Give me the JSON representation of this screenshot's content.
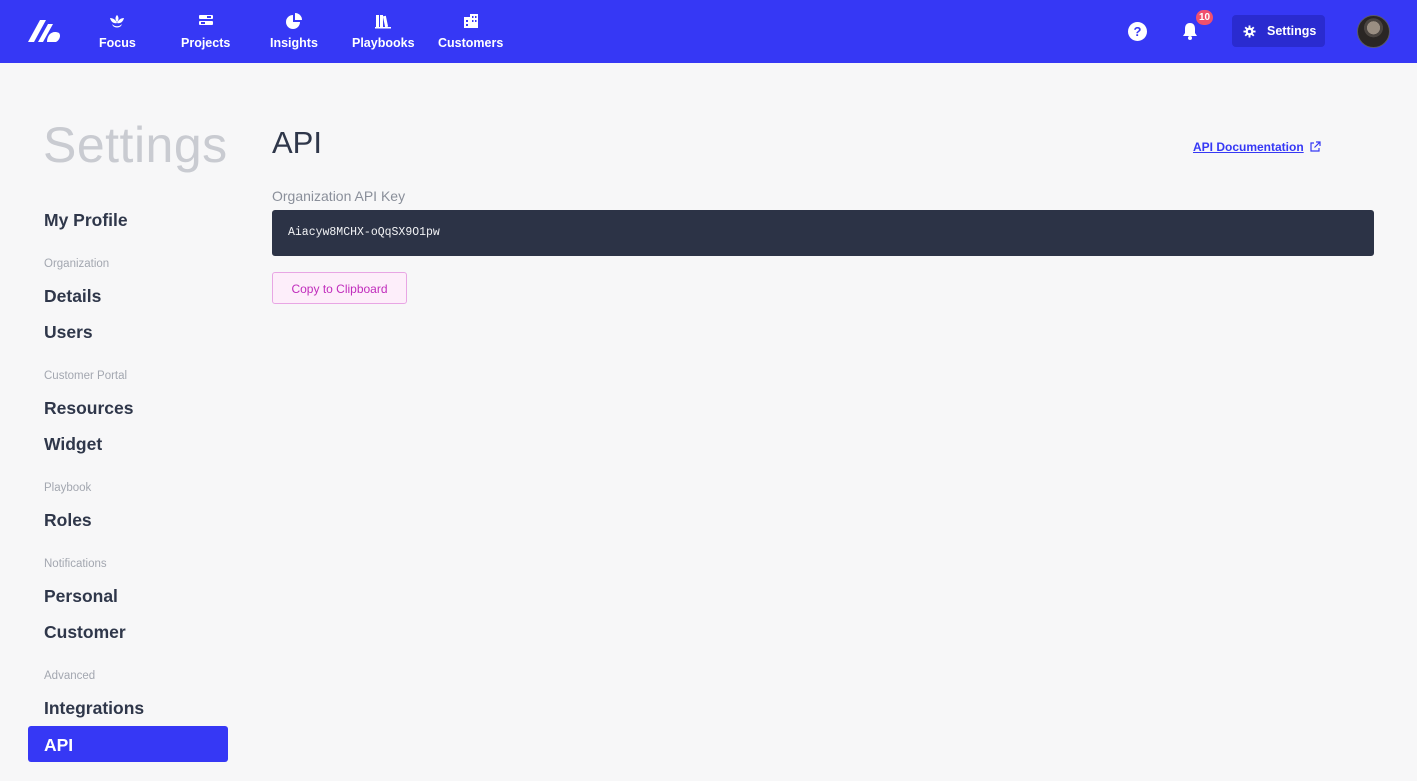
{
  "nav": {
    "items": [
      {
        "label": "Focus",
        "icon": "lotus-icon"
      },
      {
        "label": "Projects",
        "icon": "projects-icon"
      },
      {
        "label": "Insights",
        "icon": "pie-chart-icon"
      },
      {
        "label": "Playbooks",
        "icon": "books-icon"
      },
      {
        "label": "Customers",
        "icon": "building-icon"
      }
    ],
    "help_label": "?",
    "notification_count": "10",
    "settings_label": "Settings",
    "brand_color": "#3638f5"
  },
  "sidebar": {
    "title": "Settings",
    "my_profile": "My Profile",
    "sections": [
      {
        "heading": "Organization",
        "items": [
          "Details",
          "Users"
        ]
      },
      {
        "heading": "Customer Portal",
        "items": [
          "Resources",
          "Widget"
        ]
      },
      {
        "heading": "Playbook",
        "items": [
          "Roles"
        ]
      },
      {
        "heading": "Notifications",
        "items": [
          "Personal",
          "Customer"
        ]
      },
      {
        "heading": "Advanced",
        "items": [
          "Integrations",
          "API"
        ]
      }
    ],
    "active_item": "API"
  },
  "main": {
    "title": "API",
    "doc_link": "API Documentation",
    "key_label": "Organization API Key",
    "api_key": "Aiacyw8MCHX-oQqSX9O1pw",
    "copy_button": "Copy to Clipboard"
  }
}
